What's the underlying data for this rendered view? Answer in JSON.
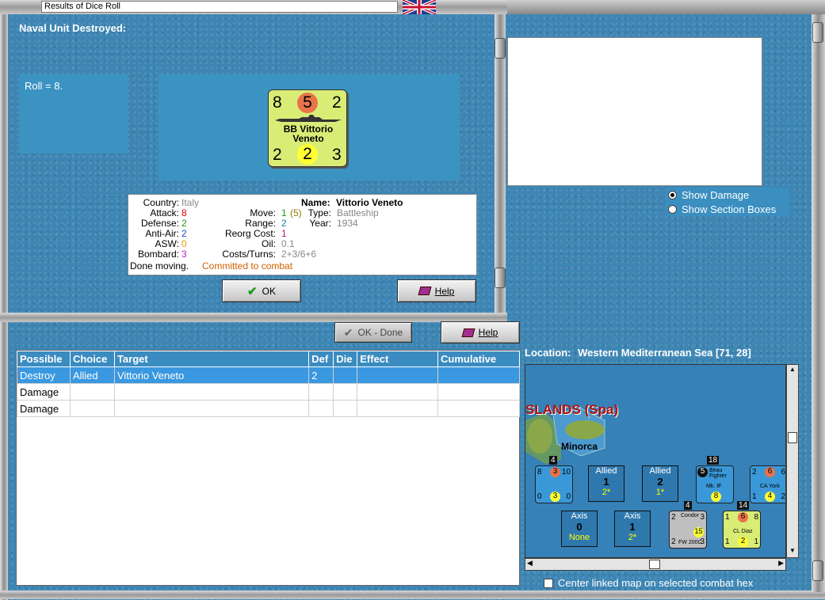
{
  "window": {
    "title": "Results of Dice Roll"
  },
  "dialog": {
    "heading": "Naval Unit Destroyed:",
    "roll_text": "Roll = 8.",
    "counter": {
      "top_left": "8",
      "top_center": "5",
      "top_right": "2",
      "name_line1": "BB Vittorio",
      "name_line2": "Veneto",
      "bottom_left": "2",
      "bottom_center": "2",
      "bottom_right": "3"
    },
    "info": {
      "country_label": "Country:",
      "country_value": "Italy",
      "attack_label": "Attack:",
      "attack_value": "8",
      "defense_label": "Defense:",
      "defense_value": "2",
      "antiair_label": "Anti-Air:",
      "antiair_value": "2",
      "asw_label": "ASW:",
      "asw_value": "0",
      "bombard_label": "Bombard:",
      "bombard_value": "3",
      "move_label": "Move:",
      "move_value": "1",
      "move_extra": "(5)",
      "range_label": "Range:",
      "range_value": "2",
      "reorg_label": "Reorg Cost:",
      "reorg_value": "1",
      "oil_label": "Oil:",
      "oil_value": "0.1",
      "costs_label": "Costs/Turns:",
      "costs_value": "2+3/6+6",
      "name_label": "Name:",
      "name_value": "Vittorio Veneto",
      "type_label": "Type:",
      "type_value": "Battleship",
      "year_label": "Year:",
      "year_value": "1934",
      "status_1": "Done moving.",
      "status_2": "Committed to combat"
    },
    "ok_label": "OK",
    "help_label": "Help"
  },
  "toolbar": {
    "ok_done_label": "OK - Done",
    "help_label": "Help"
  },
  "table": {
    "headers": [
      "Possible",
      "Choice",
      "Target",
      "Def",
      "Die",
      "Effect",
      "Cumulative"
    ],
    "rows": [
      [
        "Destroy",
        "Allied",
        "Vittorio Veneto",
        "2",
        "",
        "",
        ""
      ],
      [
        "Damage",
        "",
        "",
        "",
        "",
        "",
        ""
      ],
      [
        "Damage",
        "",
        "",
        "",
        "",
        "",
        ""
      ]
    ]
  },
  "options": {
    "show_damage": "Show Damage",
    "show_section_boxes": "Show Section Boxes",
    "selected": "Show Damage"
  },
  "location": {
    "label": "Location:",
    "value": "Western Mediterranean Sea [71, 28]"
  },
  "map": {
    "region_label": "SLANDS (Spa)",
    "island_label": "Minorca",
    "units": {
      "u1": {
        "tl": "8",
        "tc": "3",
        "tr": "10",
        "bl": "0",
        "bc": "3",
        "br": "0",
        "badge": "4"
      },
      "allied1": {
        "side": "Allied",
        "num": "1",
        "extra": "2*"
      },
      "allied2": {
        "side": "Allied",
        "num": "2",
        "extra": "1*"
      },
      "u2": {
        "tc": "5",
        "name": "Beau Fighter",
        "sub": "Mk. IF",
        "bc": "8",
        "badge": "18"
      },
      "u3": {
        "tl": "2",
        "tc": "6",
        "tr": "6",
        "name": "CA York",
        "bl": "1",
        "bc": "4",
        "br": "2"
      },
      "axis1": {
        "side": "Axis",
        "num": "0",
        "extra": "None"
      },
      "axis2": {
        "side": "Axis",
        "num": "1",
        "extra": "2*"
      },
      "u4": {
        "tl": "2",
        "name": "Condor",
        "tr": "3",
        "bc": "15",
        "bl": "2",
        "sub": "FW 200C",
        "br": "3",
        "badge": "4"
      },
      "u5": {
        "tl": "1",
        "tc": "6",
        "tr": "8",
        "name": "CL Diaz",
        "bl": "1",
        "bc": "2",
        "br": "1",
        "badge": "14"
      }
    }
  },
  "center_check_label": "Center linked map on selected combat hex",
  "colors": {
    "sea": "#3d86b4",
    "panel": "#3b93c2",
    "counter": "#d9ec76",
    "attack": "#e8734a",
    "defense": "#ffff33"
  }
}
